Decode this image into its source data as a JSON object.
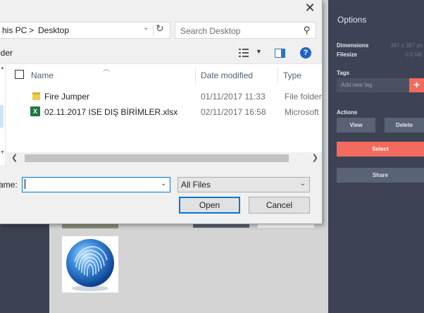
{
  "dialog": {
    "address": {
      "pc": "his PC",
      "separator": ">",
      "folder": "Desktop"
    },
    "search": {
      "placeholder": "Search Desktop"
    },
    "toolbar": {
      "new_folder": "lder"
    },
    "columns": {
      "name": "Name",
      "date": "Date modified",
      "type": "Type"
    },
    "files": [
      {
        "name": "Fire Jumper",
        "date": "01/11/2017 11:33",
        "type": "File folder",
        "icon": "folder-icon"
      },
      {
        "name": "02.11.2017 ISE DIŞ BİRİMLER.xlsx",
        "date": "02/11/2017 16:58",
        "type": "Microsoft",
        "icon": "excel-file-icon"
      }
    ],
    "file_name_label": "ame:",
    "file_name_value": "",
    "filter": "All Files",
    "open_label": "Open",
    "cancel_label": "Cancel"
  },
  "panel": {
    "title": "Options",
    "dimensions_label": "Dimensions",
    "dimensions_value": "387 x 387 px",
    "filesize_label": "Filesize",
    "filesize_value": "0.0 Mb",
    "tags_label": "Tags",
    "tag_placeholder": "Add new tag",
    "tag_add": "+",
    "actions_label": "Actions",
    "view_label": "View",
    "delete_label": "Delete",
    "select_label": "Select",
    "share_label": "Share"
  },
  "colors": {
    "accent": "#f26b5e",
    "panel_bg": "#3d4354",
    "dialog_focus": "#0078d7"
  }
}
